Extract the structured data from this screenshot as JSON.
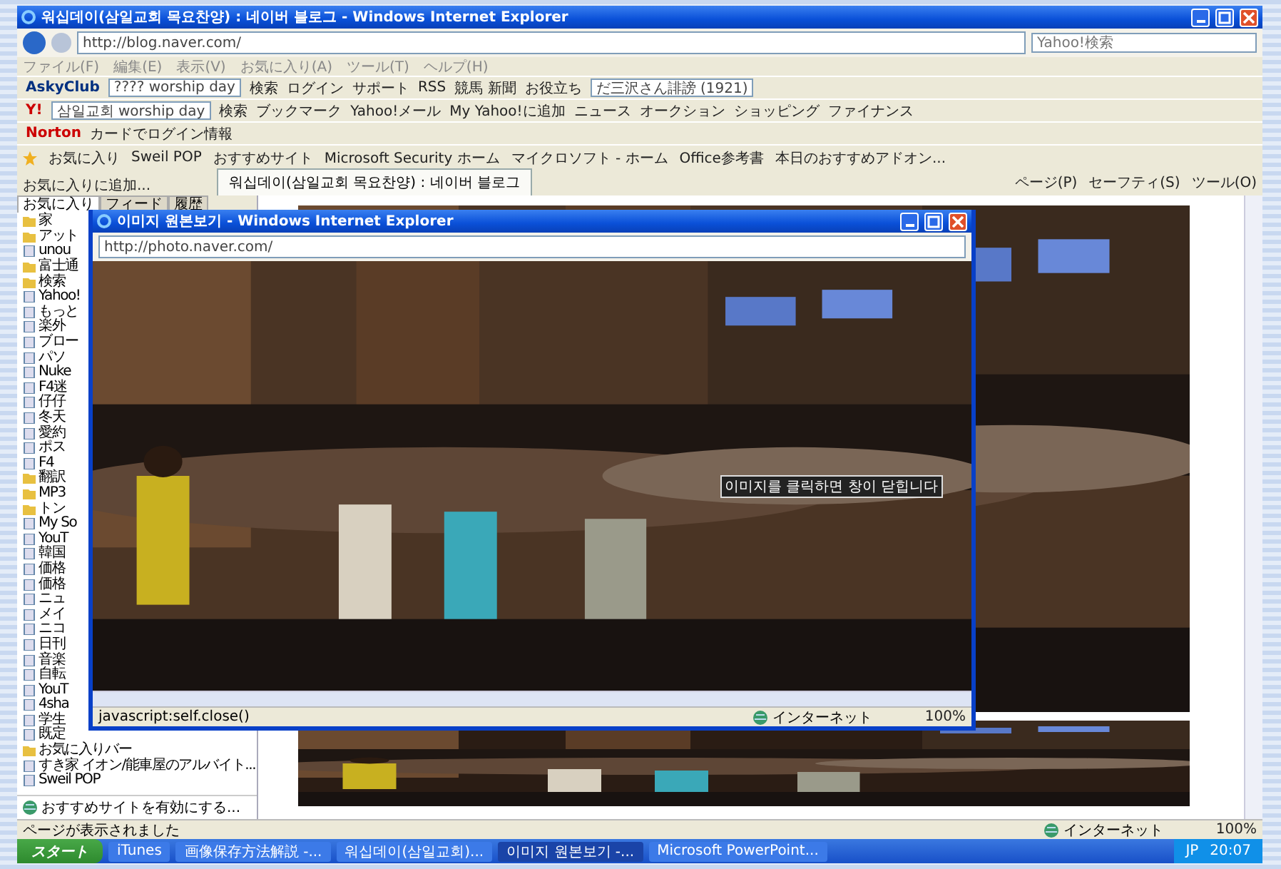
{
  "ie_window": {
    "title": "워십데이(삼일교회 목요찬양) : 네이버 블로그 - Windows Internet Explorer",
    "address": "http://blog.naver.com/",
    "search_placeholder": "Yahoo!検索",
    "menu": [
      "ファイル(F)",
      "編集(E)",
      "表示(V)",
      "お気に入り(A)",
      "ツール(T)",
      "ヘルプ(H)"
    ],
    "toolbars": [
      {
        "brand": "AskyClub",
        "items": [
          {
            "kind": "field",
            "label": "???? worship day"
          },
          {
            "kind": "button",
            "label": "検索"
          },
          {
            "kind": "button",
            "label": "ログイン"
          },
          {
            "kind": "button",
            "label": "サポート"
          },
          {
            "kind": "button",
            "label": "RSS"
          },
          {
            "kind": "button",
            "label": "競馬 新聞"
          },
          {
            "kind": "button",
            "label": "お役立ち"
          },
          {
            "kind": "field",
            "label": "だ三沢さん誹謗 (1921)"
          }
        ]
      },
      {
        "brand": "Y!",
        "items": [
          {
            "kind": "field",
            "label": "삼일교회 worship day"
          },
          {
            "kind": "button",
            "label": "検索"
          },
          {
            "kind": "button",
            "label": "ブックマーク"
          },
          {
            "kind": "button",
            "label": "Yahoo!メール"
          },
          {
            "kind": "button",
            "label": "My Yahoo!に追加"
          },
          {
            "kind": "button",
            "label": "ニュース"
          },
          {
            "kind": "button",
            "label": "オークション"
          },
          {
            "kind": "button",
            "label": "ショッピング"
          },
          {
            "kind": "button",
            "label": "ファイナンス"
          }
        ]
      },
      {
        "brand": "Norton",
        "items": [
          {
            "kind": "button",
            "label": "カードでログイン情報"
          }
        ]
      }
    ],
    "favorites_bar": {
      "label": "お気に入り",
      "items": [
        "Sweil POP",
        "おすすめサイト",
        "Microsoft Security ホーム",
        "マイクロソフト - ホーム",
        "Office参考書",
        "本日のおすすめアドオン..."
      ]
    },
    "add_favorites": "お気に入りに追加...",
    "tabs": [
      {
        "label": "워십데이(삼일교회 목요찬양) : 네이버 블로그",
        "selected": true
      }
    ],
    "command_bar": [
      "ページ(P)",
      "セーフティ(S)",
      "ツール(O)"
    ],
    "sidebar": {
      "tabs": [
        {
          "label": "お気に入り",
          "selected": true
        },
        {
          "label": "フィード",
          "selected": false
        },
        {
          "label": "履歴",
          "selected": false
        }
      ],
      "items": [
        {
          "label": "家",
          "kind": "folder"
        },
        {
          "label": "アット",
          "kind": "folder"
        },
        {
          "label": "unou",
          "kind": "link"
        },
        {
          "label": "富士通",
          "kind": "folder"
        },
        {
          "label": "検索",
          "kind": "folder"
        },
        {
          "label": "Yahoo!",
          "kind": "link"
        },
        {
          "label": "もっと",
          "kind": "link"
        },
        {
          "label": "楽外",
          "kind": "link"
        },
        {
          "label": "ブロー",
          "kind": "link"
        },
        {
          "label": "パソ",
          "kind": "link"
        },
        {
          "label": "Nuke",
          "kind": "link"
        },
        {
          "label": "F4迷",
          "kind": "link"
        },
        {
          "label": "仔仔",
          "kind": "link"
        },
        {
          "label": "冬天",
          "kind": "link"
        },
        {
          "label": "愛約",
          "kind": "link"
        },
        {
          "label": "ポス",
          "kind": "link"
        },
        {
          "label": "F4",
          "kind": "link"
        },
        {
          "label": "翻訳",
          "kind": "folder"
        },
        {
          "label": "MP3",
          "kind": "folder"
        },
        {
          "label": "トン",
          "kind": "folder"
        },
        {
          "label": "My So",
          "kind": "link"
        },
        {
          "label": "YouT",
          "kind": "link"
        },
        {
          "label": "韓国",
          "kind": "link"
        },
        {
          "label": "価格",
          "kind": "link"
        },
        {
          "label": "価格",
          "kind": "link"
        },
        {
          "label": "ニュ",
          "kind": "link"
        },
        {
          "label": "メイ",
          "kind": "link"
        },
        {
          "label": "ニコ",
          "kind": "link"
        },
        {
          "label": "日刊",
          "kind": "link"
        },
        {
          "label": "音楽",
          "kind": "link"
        },
        {
          "label": "自転",
          "kind": "link"
        },
        {
          "label": "YouT",
          "kind": "link"
        },
        {
          "label": "4sha",
          "kind": "link"
        },
        {
          "label": "学生",
          "kind": "link"
        },
        {
          "label": "既定",
          "kind": "link"
        },
        {
          "label": "お気に入りバー",
          "kind": "folder"
        },
        {
          "label": "すき家 イオン/能車屋のアルバイト...",
          "kind": "link"
        },
        {
          "label": "Sweil POP",
          "kind": "link"
        }
      ],
      "footer": "おすすめサイトを有効にする..."
    },
    "status_bar": {
      "text": "ページが表示されました",
      "zone": "インターネット",
      "zoom": "100%"
    }
  },
  "popup": {
    "title": "이미지 원본보기 - Windows Internet Explorer",
    "address": "http://photo.naver.com/",
    "overlay_label": "이미지를 클릭하면 창이 닫힙니다",
    "status_bar": {
      "text": "javascript:self.close()",
      "zone": "インターネット",
      "zoom": "100%"
    }
  },
  "taskbar": {
    "start": "スタート",
    "tasks": [
      {
        "label": "iTunes",
        "selected": false
      },
      {
        "label": "画像保存方法解説 -...",
        "selected": false
      },
      {
        "label": "워십데이(삼일교회)...",
        "selected": false
      },
      {
        "label": "이미지 원본보기 -...",
        "selected": true
      },
      {
        "label": "Microsoft PowerPoint...",
        "selected": false
      }
    ],
    "tray": {
      "language": "JP",
      "clock": "20:07"
    }
  }
}
